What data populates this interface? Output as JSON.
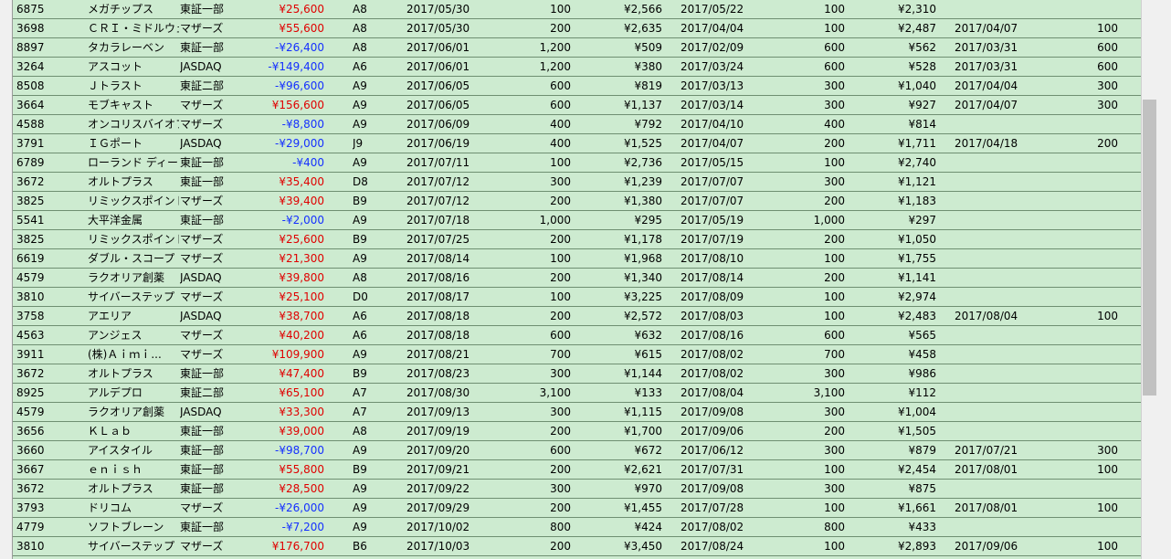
{
  "colors": {
    "row_bg": "#cdebd0",
    "negative": "#1530ff",
    "positive": "#e00000"
  },
  "scrollbar": {
    "position_fraction": 0.38,
    "visible_fraction": 0.53
  },
  "rows": [
    {
      "code": "6875",
      "name": "メガチップス",
      "market": "東証一部",
      "profit": "¥25,600",
      "sign": "pos",
      "grade": "A8",
      "date1": "2017/05/30",
      "qty1": "100",
      "price1": "¥2,566",
      "date2": "2017/05/22",
      "qty2": "100",
      "price2": "¥2,310",
      "date3": "",
      "qty3": ""
    },
    {
      "code": "3698",
      "name": "ＣＲＩ・ミドルウェア",
      "market": "マザーズ",
      "profit": "¥55,600",
      "sign": "pos",
      "grade": "A8",
      "date1": "2017/05/30",
      "qty1": "200",
      "price1": "¥2,635",
      "date2": "2017/04/04",
      "qty2": "100",
      "price2": "¥2,487",
      "date3": "2017/04/07",
      "qty3": "100"
    },
    {
      "code": "8897",
      "name": "タカラレーベン",
      "market": "東証一部",
      "profit": "-¥26,400",
      "sign": "neg",
      "grade": "A8",
      "date1": "2017/06/01",
      "qty1": "1,200",
      "price1": "¥509",
      "date2": "2017/02/09",
      "qty2": "600",
      "price2": "¥562",
      "date3": "2017/03/31",
      "qty3": "600"
    },
    {
      "code": "3264",
      "name": "アスコット",
      "market": "JASDAQ",
      "profit": "-¥149,400",
      "sign": "neg",
      "grade": "A6",
      "date1": "2017/06/01",
      "qty1": "1,200",
      "price1": "¥380",
      "date2": "2017/03/24",
      "qty2": "600",
      "price2": "¥528",
      "date3": "2017/03/31",
      "qty3": "600"
    },
    {
      "code": "8508",
      "name": "Ｊトラスト",
      "market": "東証二部",
      "profit": "-¥96,600",
      "sign": "neg",
      "grade": "A9",
      "date1": "2017/06/05",
      "qty1": "600",
      "price1": "¥819",
      "date2": "2017/03/13",
      "qty2": "300",
      "price2": "¥1,040",
      "date3": "2017/04/04",
      "qty3": "300"
    },
    {
      "code": "3664",
      "name": "モブキャスト",
      "market": "マザーズ",
      "profit": "¥156,600",
      "sign": "pos",
      "grade": "A9",
      "date1": "2017/06/05",
      "qty1": "600",
      "price1": "¥1,137",
      "date2": "2017/03/14",
      "qty2": "300",
      "price2": "¥927",
      "date3": "2017/04/07",
      "qty3": "300"
    },
    {
      "code": "4588",
      "name": "オンコリスバイオファ",
      "market": "マザーズ",
      "profit": "-¥8,800",
      "sign": "neg",
      "grade": "A9",
      "date1": "2017/06/09",
      "qty1": "400",
      "price1": "¥792",
      "date2": "2017/04/10",
      "qty2": "400",
      "price2": "¥814",
      "date3": "",
      "qty3": ""
    },
    {
      "code": "3791",
      "name": "ＩＧポート",
      "market": "JASDAQ",
      "profit": "-¥29,000",
      "sign": "neg",
      "grade": "J9",
      "date1": "2017/06/19",
      "qty1": "400",
      "price1": "¥1,525",
      "date2": "2017/04/07",
      "qty2": "200",
      "price2": "¥1,711",
      "date3": "2017/04/18",
      "qty3": "200"
    },
    {
      "code": "6789",
      "name": "ローランド ディー.",
      "market": "東証一部",
      "profit": "-¥400",
      "sign": "neg",
      "grade": "A9",
      "date1": "2017/07/11",
      "qty1": "100",
      "price1": "¥2,736",
      "date2": "2017/05/15",
      "qty2": "100",
      "price2": "¥2,740",
      "date3": "",
      "qty3": ""
    },
    {
      "code": "3672",
      "name": "オルトプラス",
      "market": "東証一部",
      "profit": "¥35,400",
      "sign": "pos",
      "grade": "D8",
      "date1": "2017/07/12",
      "qty1": "300",
      "price1": "¥1,239",
      "date2": "2017/07/07",
      "qty2": "300",
      "price2": "¥1,121",
      "date3": "",
      "qty3": ""
    },
    {
      "code": "3825",
      "name": "リミックスポイント",
      "market": "マザーズ",
      "profit": "¥39,400",
      "sign": "pos",
      "grade": "B9",
      "date1": "2017/07/12",
      "qty1": "200",
      "price1": "¥1,380",
      "date2": "2017/07/07",
      "qty2": "200",
      "price2": "¥1,183",
      "date3": "",
      "qty3": ""
    },
    {
      "code": "5541",
      "name": "大平洋金属",
      "market": "東証一部",
      "profit": "-¥2,000",
      "sign": "neg",
      "grade": "A9",
      "date1": "2017/07/18",
      "qty1": "1,000",
      "price1": "¥295",
      "date2": "2017/05/19",
      "qty2": "1,000",
      "price2": "¥297",
      "date3": "",
      "qty3": ""
    },
    {
      "code": "3825",
      "name": "リミックスポイント",
      "market": "マザーズ",
      "profit": "¥25,600",
      "sign": "pos",
      "grade": "B9",
      "date1": "2017/07/25",
      "qty1": "200",
      "price1": "¥1,178",
      "date2": "2017/07/19",
      "qty2": "200",
      "price2": "¥1,050",
      "date3": "",
      "qty3": ""
    },
    {
      "code": "6619",
      "name": "ダブル・スコープ",
      "market": "マザーズ",
      "profit": "¥21,300",
      "sign": "pos",
      "grade": "A9",
      "date1": "2017/08/14",
      "qty1": "100",
      "price1": "¥1,968",
      "date2": "2017/08/10",
      "qty2": "100",
      "price2": "¥1,755",
      "date3": "",
      "qty3": ""
    },
    {
      "code": "4579",
      "name": "ラクオリア創薬",
      "market": "JASDAQ",
      "profit": "¥39,800",
      "sign": "pos",
      "grade": "A8",
      "date1": "2017/08/16",
      "qty1": "200",
      "price1": "¥1,340",
      "date2": "2017/08/14",
      "qty2": "200",
      "price2": "¥1,141",
      "date3": "",
      "qty3": ""
    },
    {
      "code": "3810",
      "name": "サイバーステップ",
      "market": "マザーズ",
      "profit": "¥25,100",
      "sign": "pos",
      "grade": "D0",
      "date1": "2017/08/17",
      "qty1": "100",
      "price1": "¥3,225",
      "date2": "2017/08/09",
      "qty2": "100",
      "price2": "¥2,974",
      "date3": "",
      "qty3": ""
    },
    {
      "code": "3758",
      "name": "アエリア",
      "market": "JASDAQ",
      "profit": "¥38,700",
      "sign": "pos",
      "grade": "A6",
      "date1": "2017/08/18",
      "qty1": "200",
      "price1": "¥2,572",
      "date2": "2017/08/03",
      "qty2": "100",
      "price2": "¥2,483",
      "date3": "2017/08/04",
      "qty3": "100"
    },
    {
      "code": "4563",
      "name": "アンジェス",
      "market": "マザーズ",
      "profit": "¥40,200",
      "sign": "pos",
      "grade": "A6",
      "date1": "2017/08/18",
      "qty1": "600",
      "price1": "¥632",
      "date2": "2017/08/16",
      "qty2": "600",
      "price2": "¥565",
      "date3": "",
      "qty3": ""
    },
    {
      "code": "3911",
      "name": "(株)Ａｉｍｉ...",
      "market": "マザーズ",
      "profit": "¥109,900",
      "sign": "pos",
      "grade": "A9",
      "date1": "2017/08/21",
      "qty1": "700",
      "price1": "¥615",
      "date2": "2017/08/02",
      "qty2": "700",
      "price2": "¥458",
      "date3": "",
      "qty3": ""
    },
    {
      "code": "3672",
      "name": "オルトプラス",
      "market": "東証一部",
      "profit": "¥47,400",
      "sign": "pos",
      "grade": "B9",
      "date1": "2017/08/23",
      "qty1": "300",
      "price1": "¥1,144",
      "date2": "2017/08/02",
      "qty2": "300",
      "price2": "¥986",
      "date3": "",
      "qty3": ""
    },
    {
      "code": "8925",
      "name": "アルデプロ",
      "market": "東証二部",
      "profit": "¥65,100",
      "sign": "pos",
      "grade": "A7",
      "date1": "2017/08/30",
      "qty1": "3,100",
      "price1": "¥133",
      "date2": "2017/08/04",
      "qty2": "3,100",
      "price2": "¥112",
      "date3": "",
      "qty3": ""
    },
    {
      "code": "4579",
      "name": "ラクオリア創薬",
      "market": "JASDAQ",
      "profit": "¥33,300",
      "sign": "pos",
      "grade": "A7",
      "date1": "2017/09/13",
      "qty1": "300",
      "price1": "¥1,115",
      "date2": "2017/09/08",
      "qty2": "300",
      "price2": "¥1,004",
      "date3": "",
      "qty3": ""
    },
    {
      "code": "3656",
      "name": "ＫＬａｂ",
      "market": "東証一部",
      "profit": "¥39,000",
      "sign": "pos",
      "grade": "A8",
      "date1": "2017/09/19",
      "qty1": "200",
      "price1": "¥1,700",
      "date2": "2017/09/06",
      "qty2": "200",
      "price2": "¥1,505",
      "date3": "",
      "qty3": ""
    },
    {
      "code": "3660",
      "name": "アイスタイル",
      "market": "東証一部",
      "profit": "-¥98,700",
      "sign": "neg",
      "grade": "A9",
      "date1": "2017/09/20",
      "qty1": "600",
      "price1": "¥672",
      "date2": "2017/06/12",
      "qty2": "300",
      "price2": "¥879",
      "date3": "2017/07/21",
      "qty3": "300"
    },
    {
      "code": "3667",
      "name": "ｅｎｉｓｈ",
      "market": "東証一部",
      "profit": "¥55,800",
      "sign": "pos",
      "grade": "B9",
      "date1": "2017/09/21",
      "qty1": "200",
      "price1": "¥2,621",
      "date2": "2017/07/31",
      "qty2": "100",
      "price2": "¥2,454",
      "date3": "2017/08/01",
      "qty3": "100"
    },
    {
      "code": "3672",
      "name": "オルトプラス",
      "market": "東証一部",
      "profit": "¥28,500",
      "sign": "pos",
      "grade": "A9",
      "date1": "2017/09/22",
      "qty1": "300",
      "price1": "¥970",
      "date2": "2017/09/08",
      "qty2": "300",
      "price2": "¥875",
      "date3": "",
      "qty3": ""
    },
    {
      "code": "3793",
      "name": "ドリコム",
      "market": "マザーズ",
      "profit": "-¥26,000",
      "sign": "neg",
      "grade": "A9",
      "date1": "2017/09/29",
      "qty1": "200",
      "price1": "¥1,455",
      "date2": "2017/07/28",
      "qty2": "100",
      "price2": "¥1,661",
      "date3": "2017/08/01",
      "qty3": "100"
    },
    {
      "code": "4779",
      "name": "ソフトブレーン",
      "market": "東証一部",
      "profit": "-¥7,200",
      "sign": "neg",
      "grade": "A9",
      "date1": "2017/10/02",
      "qty1": "800",
      "price1": "¥424",
      "date2": "2017/08/02",
      "qty2": "800",
      "price2": "¥433",
      "date3": "",
      "qty3": ""
    },
    {
      "code": "3810",
      "name": "サイバーステップ",
      "market": "マザーズ",
      "profit": "¥176,700",
      "sign": "pos",
      "grade": "B6",
      "date1": "2017/10/03",
      "qty1": "200",
      "price1": "¥3,450",
      "date2": "2017/08/24",
      "qty2": "100",
      "price2": "¥2,893",
      "date3": "2017/09/06",
      "qty3": "100"
    }
  ]
}
